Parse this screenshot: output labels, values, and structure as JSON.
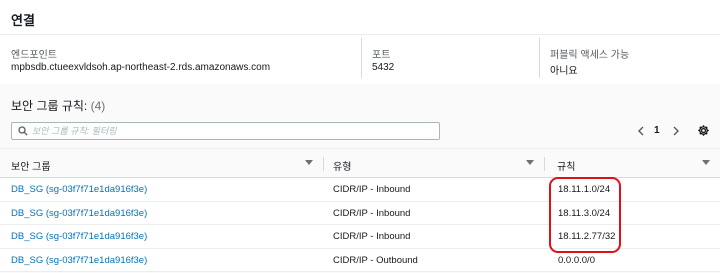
{
  "connection": {
    "title": "연결",
    "endpoint_label": "엔드포인트",
    "endpoint_value": "mpbsdb.ctueexvldsoh.ap-northeast-2.rds.amazonaws.com",
    "port_label": "포트",
    "port_value": "5432",
    "public_label": "퍼블릭 액세스 가능",
    "public_value": "아니요"
  },
  "rules": {
    "title": "보안 그룹 규칙:",
    "count": "(4)",
    "search_placeholder": "보안 그룹 규칙: 필터링",
    "current_page": "1",
    "columns": [
      "보안 그룹",
      "유형",
      "규칙"
    ],
    "rows": [
      {
        "group": "DB_SG (sg-03f7f71e1da916f3e)",
        "type": "CIDR/IP - Inbound",
        "rule": "18.11.1.0/24"
      },
      {
        "group": "DB_SG (sg-03f7f71e1da916f3e)",
        "type": "CIDR/IP - Inbound",
        "rule": "18.11.3.0/24"
      },
      {
        "group": "DB_SG (sg-03f7f71e1da916f3e)",
        "type": "CIDR/IP - Inbound",
        "rule": "18.11.2.77/32"
      },
      {
        "group": "DB_SG (sg-03f7f71e1da916f3e)",
        "type": "CIDR/IP - Outbound",
        "rule": "0.0.0.0/0"
      }
    ]
  },
  "icons": {
    "search": "search-icon",
    "prev": "chevron-left-icon",
    "next": "chevron-right-icon",
    "settings": "gear-icon",
    "sort": "caret-down-icon"
  },
  "colors": {
    "link": "#0073bb",
    "highlight": "#e0101a"
  }
}
